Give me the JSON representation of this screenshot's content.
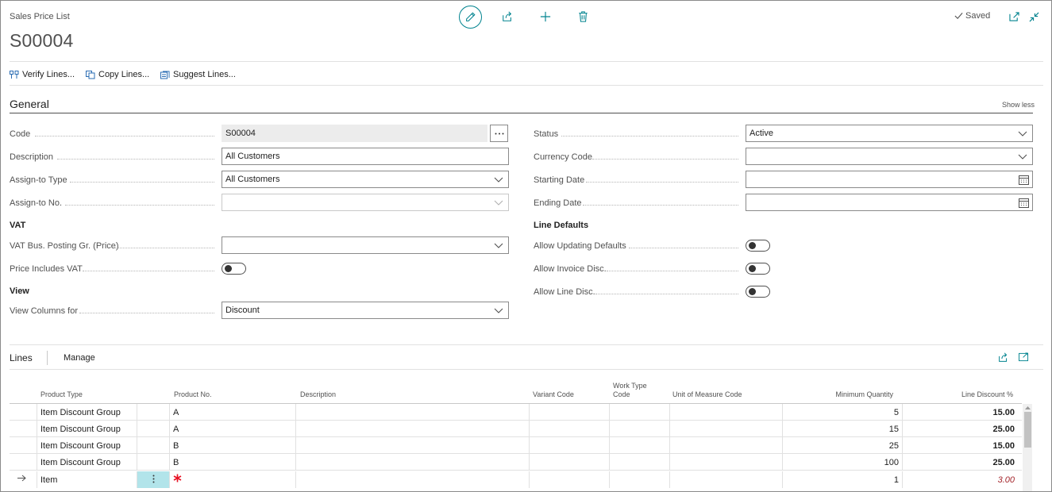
{
  "header": {
    "caption": "Sales Price List",
    "title": "S00004",
    "saved_label": "Saved"
  },
  "actions": [
    {
      "label": "Verify Lines..."
    },
    {
      "label": "Copy Lines..."
    },
    {
      "label": "Suggest Lines..."
    }
  ],
  "general": {
    "title": "General",
    "show_less": "Show less",
    "fields": {
      "code": {
        "label": "Code",
        "value": "S00004"
      },
      "description": {
        "label": "Description",
        "value": "All Customers"
      },
      "assign_to_type": {
        "label": "Assign-to Type",
        "value": "All Customers"
      },
      "assign_to_no": {
        "label": "Assign-to No.",
        "value": ""
      },
      "vat_heading": "VAT",
      "vat_bus_posting": {
        "label": "VAT Bus. Posting Gr. (Price)",
        "value": ""
      },
      "price_includes_vat": {
        "label": "Price Includes VAT",
        "on": false
      },
      "view_heading": "View",
      "view_columns_for": {
        "label": "View Columns for",
        "value": "Discount"
      },
      "status": {
        "label": "Status",
        "value": "Active"
      },
      "currency_code": {
        "label": "Currency Code",
        "value": ""
      },
      "starting_date": {
        "label": "Starting Date",
        "value": ""
      },
      "ending_date": {
        "label": "Ending Date",
        "value": ""
      },
      "line_defaults_heading": "Line Defaults",
      "allow_updating_defaults": {
        "label": "Allow Updating Defaults",
        "on": false
      },
      "allow_invoice_disc": {
        "label": "Allow Invoice Disc.",
        "on": false
      },
      "allow_line_disc": {
        "label": "Allow Line Disc.",
        "on": false
      }
    }
  },
  "lines": {
    "title": "Lines",
    "manage": "Manage",
    "columns": {
      "product_type": "Product Type",
      "product_no": "Product No.",
      "description": "Description",
      "variant_code": "Variant Code",
      "work_type_code_1": "Work Type",
      "work_type_code_2": "Code",
      "uom_code": "Unit of Measure Code",
      "min_qty": "Minimum Quantity",
      "line_discount": "Line Discount %"
    },
    "rows": [
      {
        "product_type": "Item Discount Group",
        "product_no": "A",
        "min_qty": "5",
        "line_discount": "15.00"
      },
      {
        "product_type": "Item Discount Group",
        "product_no": "A",
        "min_qty": "15",
        "line_discount": "25.00"
      },
      {
        "product_type": "Item Discount Group",
        "product_no": "B",
        "min_qty": "25",
        "line_discount": "15.00"
      },
      {
        "product_type": "Item Discount Group",
        "product_no": "B",
        "min_qty": "100",
        "line_discount": "25.00"
      },
      {
        "product_type": "Item",
        "product_no": "",
        "min_qty": "1",
        "line_discount": "3.00"
      }
    ]
  },
  "colors": {
    "accent": "#00838f",
    "required": "#e81123",
    "italic_red": "#a4262c"
  }
}
